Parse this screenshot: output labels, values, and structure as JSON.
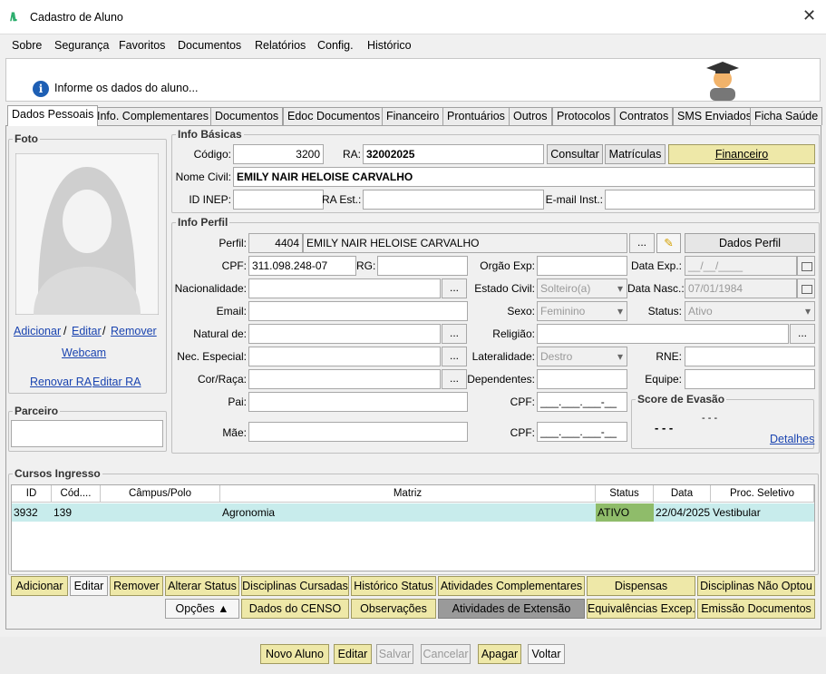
{
  "window": {
    "title": "Cadastro de Aluno",
    "close": "✕"
  },
  "menu": [
    "Sobre",
    "Segurança",
    "Favoritos",
    "Documentos",
    "Relatórios",
    "Config.",
    "Histórico"
  ],
  "info_message": "Informe os dados do aluno...",
  "tabs": [
    "Dados Pessoais",
    "Info. Complementares",
    "Documentos",
    "Edoc Documentos",
    "Financeiro",
    "Prontuários",
    "Outros",
    "Protocolos",
    "Contratos",
    "SMS Enviados",
    "Ficha Saúde"
  ],
  "foto": {
    "title": "Foto",
    "adicionar": "Adicionar",
    "editar": "Editar",
    "remover": "Remover",
    "sep": "/",
    "webcam": "Webcam",
    "renovar_ra": "Renovar RA",
    "editar_ra": "Editar RA"
  },
  "parceiro": {
    "title": "Parceiro"
  },
  "basicas": {
    "title": "Info Básicas",
    "codigo_label": "Código:",
    "codigo": "3200",
    "ra_label": "RA:",
    "ra": "32002025",
    "consultar": "Consultar",
    "matriculas": "Matrículas",
    "financeiro": "Financeiro",
    "nome_label": "Nome Civil:",
    "nome": "EMILY NAIR HELOISE CARVALHO",
    "inep_label": "ID INEP:",
    "ra_est_label": "RA Est.:",
    "email_inst_label": "E-mail Inst.:"
  },
  "perfil": {
    "title": "Info Perfil",
    "perfil_label": "Perfil:",
    "perfil_id": "4404",
    "perfil_nome": "EMILY NAIR HELOISE CARVALHO",
    "dots": "...",
    "dados_perfil": "Dados Perfil",
    "cpf_label": "CPF:",
    "cpf": "311.098.248-07",
    "rg_label": "RG:",
    "orgao_label": "Orgão Exp:",
    "data_exp_label": "Data Exp.:",
    "data_exp": "__/__/____",
    "nacionalidade_label": "Nacionalidade:",
    "estado_civil_label": "Estado Civil:",
    "estado_civil": "Solteiro(a)",
    "data_nasc_label": "Data Nasc.:",
    "data_nasc": "07/01/1984",
    "email_label": "Email:",
    "sexo_label": "Sexo:",
    "sexo": "Feminino",
    "status_label": "Status:",
    "status": "Ativo",
    "natural_label": "Natural de:",
    "religiao_label": "Religião:",
    "nec_label": "Nec. Especial:",
    "lateralidade_label": "Lateralidade:",
    "lateralidade": "Destro",
    "rne_label": "RNE:",
    "cor_label": "Cor/Raça:",
    "dependentes_label": "Dependentes:",
    "equipe_label": "Equipe:",
    "pai_label": "Pai:",
    "cpf2_label": "CPF:",
    "cpf_mask": "___.___.___-__",
    "mae_label": "Mãe:",
    "cpf3_label": "CPF:",
    "score_title": "Score de Evasão",
    "score_main": "- - -",
    "score_sub": "- - -",
    "detalhes": "Detalhes"
  },
  "cursos": {
    "title": "Cursos Ingresso",
    "columns": [
      "ID",
      "Cód....",
      "Câmpus/Polo",
      "Matriz",
      "Status",
      "Data",
      "Proc. Seletivo"
    ],
    "rows": [
      {
        "id": "3932",
        "cod": "139",
        "campus": "",
        "matriz": "Agronomia",
        "status": "ATIVO",
        "data": "22/04/2025",
        "proc": "Vestibular"
      }
    ]
  },
  "actions1": [
    "Adicionar",
    "Editar",
    "Remover",
    "Alterar Status",
    "Disciplinas Cursadas",
    "Histórico Status",
    "Atividades Complementares",
    "Dispensas",
    "Disciplinas Não Optou"
  ],
  "actions2": [
    "Opções ▲",
    "Dados do CENSO",
    "Observações",
    "Atividades de Extensão",
    "Equivalências Excep.",
    "Emissão Documentos"
  ],
  "bottom": [
    "Novo Aluno",
    "Editar",
    "Salvar",
    "Cancelar",
    "Apagar",
    "Voltar"
  ],
  "colors": {
    "accent_yellow": "#eee8a8",
    "row_bg": "#c8ecec",
    "status_green": "#8fbc6a",
    "link": "#1a44b0"
  }
}
